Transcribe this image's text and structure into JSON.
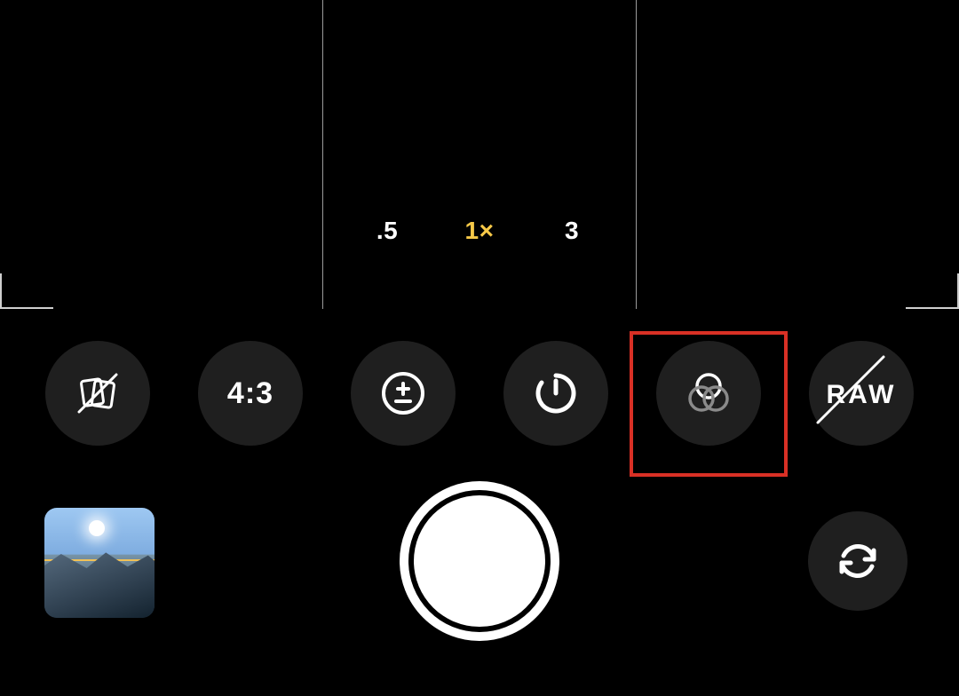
{
  "zoom": {
    "options": [
      {
        "label": ".5",
        "active": false
      },
      {
        "label": "1×",
        "active": true
      },
      {
        "label": "3",
        "active": false
      }
    ]
  },
  "controls": {
    "aspect_label": "4:3",
    "raw_label": "RAW"
  },
  "highlight": {
    "target": "filters-button"
  }
}
